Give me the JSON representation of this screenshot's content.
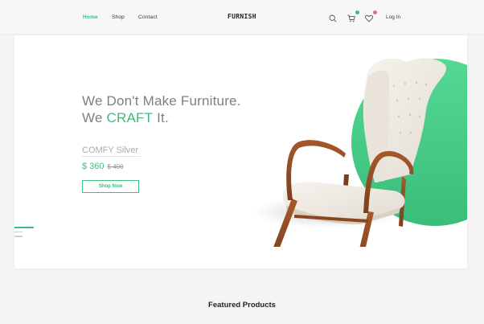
{
  "nav": {
    "links": [
      {
        "label": "Home",
        "active": true
      },
      {
        "label": "Shop",
        "active": false
      },
      {
        "label": "Contact",
        "active": false
      }
    ],
    "brand": "FURNISH",
    "login_label": "Log In",
    "icons": [
      "search-icon",
      "cart-icon",
      "heart-icon"
    ],
    "cart_badge_color": "#3dbd7d",
    "wishlist_badge_color": "#f06a7a"
  },
  "hero": {
    "heading_line1": "We Don't Make Furniture.",
    "heading_line2_prefix": "We ",
    "heading_line2_accent": "CRAFT",
    "heading_line2_suffix": " It.",
    "product_name": "COMFY Silver",
    "price": "$ 360",
    "old_price": "$ 400",
    "cta_label": "Shop Now",
    "accent_color": "#3dbd7d"
  },
  "featured": {
    "title": "Featured Products"
  }
}
